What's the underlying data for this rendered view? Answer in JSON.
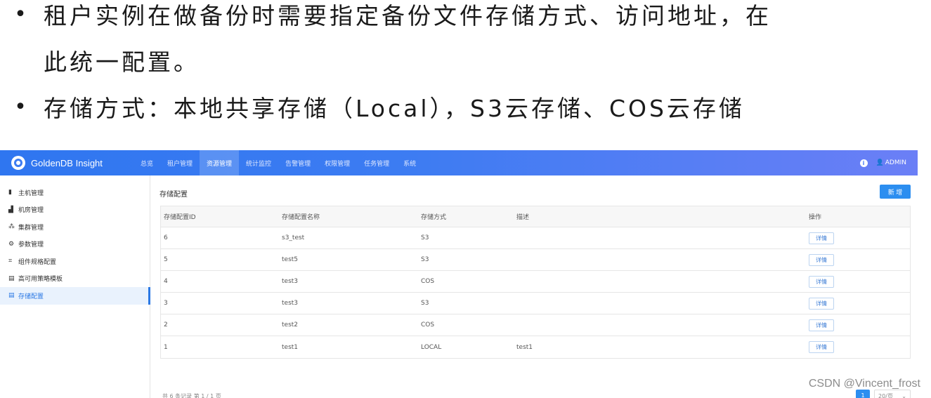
{
  "slide": {
    "bullet_mark": "•",
    "line1": "租户实例在做备份时需要指定备份文件存储方式、访问地址，在",
    "line1_cont": "此统一配置。",
    "line2": "存储方式：本地共享存储（Local），S3云存储、COS云存储"
  },
  "app": {
    "brand": "GoldenDB Insight",
    "nav": [
      "总览",
      "租户管理",
      "资源管理",
      "统计监控",
      "告警管理",
      "权限管理",
      "任务管理",
      "系统"
    ],
    "active_nav": "资源管理",
    "user": "ADMIN",
    "info_icon_glyph": "i",
    "user_icon_glyph": "👤"
  },
  "sidebar": {
    "items": [
      {
        "label": "主机管理",
        "icon": "server-icon",
        "glyph": "▮"
      },
      {
        "label": "机房管理",
        "icon": "building-icon",
        "glyph": "▟"
      },
      {
        "label": "集群管理",
        "icon": "cluster-icon",
        "glyph": "⁂"
      },
      {
        "label": "参数管理",
        "icon": "settings-icon",
        "glyph": "⚙"
      },
      {
        "label": "组件规格配置",
        "icon": "spec-icon",
        "glyph": "⌗"
      },
      {
        "label": "高可用策略模板",
        "icon": "template-icon",
        "glyph": "▤"
      },
      {
        "label": "存储配置",
        "icon": "storage-icon",
        "glyph": "▤"
      }
    ],
    "active": "存储配置"
  },
  "main": {
    "title": "存储配置",
    "add_label": "新 增",
    "columns": [
      "存储配置ID",
      "存储配置名称",
      "存储方式",
      "描述",
      "操作"
    ],
    "rows": [
      {
        "id": "6",
        "name": "s3_test",
        "type": "S3",
        "desc": "",
        "action": "详情"
      },
      {
        "id": "5",
        "name": "test5",
        "type": "S3",
        "desc": "",
        "action": "详情"
      },
      {
        "id": "4",
        "name": "test3",
        "type": "COS",
        "desc": "",
        "action": "详情"
      },
      {
        "id": "3",
        "name": "test3",
        "type": "S3",
        "desc": "",
        "action": "详情"
      },
      {
        "id": "2",
        "name": "test2",
        "type": "COS",
        "desc": "",
        "action": "详情"
      },
      {
        "id": "1",
        "name": "test1",
        "type": "LOCAL",
        "desc": "test1",
        "action": "详情"
      }
    ],
    "footer_info": "共 6 条记录   第 1 / 1 页",
    "current_page": "1",
    "page_size": "20/页",
    "page_size_arrow": "⌄"
  },
  "watermark": "CSDN @Vincent_frost",
  "colors": {
    "topbar_start": "#2f76f0",
    "topbar_end": "#6b7ff6",
    "accent": "#2c8ef0",
    "active_side_bg": "#e9f2fd"
  }
}
